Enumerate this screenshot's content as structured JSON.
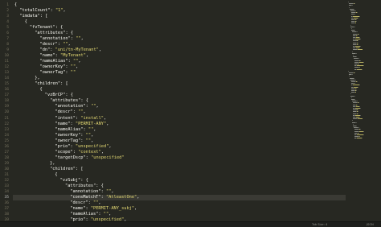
{
  "editor": {
    "language": "json",
    "active_line": 35,
    "colors": {
      "background": "#272822",
      "key": "#f8f8f2",
      "string": "#e6db74",
      "punctuation": "#f8f8f2",
      "line_number": "#75715e",
      "active_line_highlight": "#3a3a34"
    },
    "lines": [
      {
        "n": "1",
        "indent": 0,
        "tokens": [
          [
            "p",
            "{"
          ]
        ]
      },
      {
        "n": "2",
        "indent": 1,
        "tokens": [
          [
            "k",
            "\"totalCount\""
          ],
          [
            "p",
            ": "
          ],
          [
            "s",
            "\"1\""
          ],
          [
            "p",
            ","
          ]
        ]
      },
      {
        "n": "3",
        "indent": 1,
        "tokens": [
          [
            "k",
            "\"imdata\""
          ],
          [
            "p",
            ": ["
          ]
        ]
      },
      {
        "n": "4",
        "indent": 2,
        "tokens": [
          [
            "p",
            "{"
          ]
        ]
      },
      {
        "n": "5",
        "indent": 3,
        "tokens": [
          [
            "k",
            "\"fvTenant\""
          ],
          [
            "p",
            ": {"
          ]
        ]
      },
      {
        "n": "6",
        "indent": 4,
        "tokens": [
          [
            "k",
            "\"attributes\""
          ],
          [
            "p",
            ": {"
          ]
        ]
      },
      {
        "n": "7",
        "indent": 5,
        "tokens": [
          [
            "k",
            "\"annotation\""
          ],
          [
            "p",
            ": "
          ],
          [
            "s",
            "\"\""
          ],
          [
            "p",
            ","
          ]
        ]
      },
      {
        "n": "8",
        "indent": 5,
        "tokens": [
          [
            "k",
            "\"descr\""
          ],
          [
            "p",
            ": "
          ],
          [
            "s",
            "\"\""
          ],
          [
            "p",
            ","
          ]
        ]
      },
      {
        "n": "9",
        "indent": 5,
        "tokens": [
          [
            "k",
            "\"dn\""
          ],
          [
            "p",
            ": "
          ],
          [
            "s",
            "\"uni/tn-MyTenant\""
          ],
          [
            "p",
            ","
          ]
        ]
      },
      {
        "n": "10",
        "indent": 5,
        "tokens": [
          [
            "k",
            "\"name\""
          ],
          [
            "p",
            ": "
          ],
          [
            "s",
            "\"MyTenant\""
          ],
          [
            "p",
            ","
          ]
        ]
      },
      {
        "n": "11",
        "indent": 5,
        "tokens": [
          [
            "k",
            "\"nameAlias\""
          ],
          [
            "p",
            ": "
          ],
          [
            "s",
            "\"\""
          ],
          [
            "p",
            ","
          ]
        ]
      },
      {
        "n": "12",
        "indent": 5,
        "tokens": [
          [
            "k",
            "\"ownerKey\""
          ],
          [
            "p",
            ": "
          ],
          [
            "s",
            "\"\""
          ],
          [
            "p",
            ","
          ]
        ]
      },
      {
        "n": "13",
        "indent": 5,
        "tokens": [
          [
            "k",
            "\"ownerTag\""
          ],
          [
            "p",
            ": "
          ],
          [
            "s",
            "\"\""
          ]
        ]
      },
      {
        "n": "14",
        "indent": 4,
        "tokens": [
          [
            "p",
            "},"
          ]
        ]
      },
      {
        "n": "15",
        "indent": 4,
        "tokens": [
          [
            "k",
            "\"children\""
          ],
          [
            "p",
            ": ["
          ]
        ]
      },
      {
        "n": "16",
        "indent": 5,
        "tokens": [
          [
            "p",
            "{"
          ]
        ]
      },
      {
        "n": "17",
        "indent": 6,
        "tokens": [
          [
            "k",
            "\"vzBrCP\""
          ],
          [
            "p",
            ": {"
          ]
        ]
      },
      {
        "n": "18",
        "indent": 7,
        "tokens": [
          [
            "k",
            "\"attributes\""
          ],
          [
            "p",
            ": {"
          ]
        ]
      },
      {
        "n": "19",
        "indent": 8,
        "tokens": [
          [
            "k",
            "\"annotation\""
          ],
          [
            "p",
            ": "
          ],
          [
            "s",
            "\"\""
          ],
          [
            "p",
            ","
          ]
        ]
      },
      {
        "n": "20",
        "indent": 8,
        "tokens": [
          [
            "k",
            "\"descr\""
          ],
          [
            "p",
            ": "
          ],
          [
            "s",
            "\"\""
          ],
          [
            "p",
            ","
          ]
        ]
      },
      {
        "n": "21",
        "indent": 8,
        "tokens": [
          [
            "k",
            "\"intent\""
          ],
          [
            "p",
            ": "
          ],
          [
            "s",
            "\"install\""
          ],
          [
            "p",
            ","
          ]
        ]
      },
      {
        "n": "22",
        "indent": 8,
        "tokens": [
          [
            "k",
            "\"name\""
          ],
          [
            "p",
            ": "
          ],
          [
            "s",
            "\"PERMIT-ANY\""
          ],
          [
            "p",
            ","
          ]
        ]
      },
      {
        "n": "23",
        "indent": 8,
        "tokens": [
          [
            "k",
            "\"nameAlias\""
          ],
          [
            "p",
            ": "
          ],
          [
            "s",
            "\"\""
          ],
          [
            "p",
            ","
          ]
        ]
      },
      {
        "n": "24",
        "indent": 8,
        "tokens": [
          [
            "k",
            "\"ownerKey\""
          ],
          [
            "p",
            ": "
          ],
          [
            "s",
            "\"\""
          ],
          [
            "p",
            ","
          ]
        ]
      },
      {
        "n": "25",
        "indent": 8,
        "tokens": [
          [
            "k",
            "\"ownerTag\""
          ],
          [
            "p",
            ": "
          ],
          [
            "s",
            "\"\""
          ],
          [
            "p",
            ","
          ]
        ]
      },
      {
        "n": "26",
        "indent": 8,
        "tokens": [
          [
            "k",
            "\"prio\""
          ],
          [
            "p",
            ": "
          ],
          [
            "s",
            "\"unspecified\""
          ],
          [
            "p",
            ","
          ]
        ]
      },
      {
        "n": "27",
        "indent": 8,
        "tokens": [
          [
            "k",
            "\"scope\""
          ],
          [
            "p",
            ": "
          ],
          [
            "s",
            "\"context\""
          ],
          [
            "p",
            ","
          ]
        ]
      },
      {
        "n": "28",
        "indent": 8,
        "tokens": [
          [
            "k",
            "\"targetDscp\""
          ],
          [
            "p",
            ": "
          ],
          [
            "s",
            "\"unspecified\""
          ]
        ]
      },
      {
        "n": "29",
        "indent": 7,
        "tokens": [
          [
            "p",
            "},"
          ]
        ]
      },
      {
        "n": "30",
        "indent": 7,
        "tokens": [
          [
            "k",
            "\"children\""
          ],
          [
            "p",
            ": ["
          ]
        ]
      },
      {
        "n": "31",
        "indent": 8,
        "tokens": [
          [
            "p",
            "{"
          ]
        ]
      },
      {
        "n": "32",
        "indent": 9,
        "tokens": [
          [
            "k",
            "\"vzSubj\""
          ],
          [
            "p",
            ": {"
          ]
        ]
      },
      {
        "n": "33",
        "indent": 10,
        "tokens": [
          [
            "k",
            "\"attributes\""
          ],
          [
            "p",
            ": {"
          ]
        ]
      },
      {
        "n": "34",
        "indent": 11,
        "tokens": [
          [
            "k",
            "\"annotation\""
          ],
          [
            "p",
            ": "
          ],
          [
            "s",
            "\"\""
          ],
          [
            "p",
            ","
          ]
        ]
      },
      {
        "n": "35",
        "indent": 11,
        "tokens": [
          [
            "k",
            "\"consMatchT\""
          ],
          [
            "p",
            ": "
          ],
          [
            "s",
            "\"AtleastOne\""
          ],
          [
            "p",
            ","
          ]
        ]
      },
      {
        "n": "36",
        "indent": 11,
        "tokens": [
          [
            "k",
            "\"descr\""
          ],
          [
            "p",
            ": "
          ],
          [
            "s",
            "\"\""
          ],
          [
            "p",
            ","
          ]
        ]
      },
      {
        "n": "37",
        "indent": 11,
        "tokens": [
          [
            "k",
            "\"name\""
          ],
          [
            "p",
            ": "
          ],
          [
            "s",
            "\"PERMIT-ANY_subj\""
          ],
          [
            "p",
            ","
          ]
        ]
      },
      {
        "n": "38",
        "indent": 11,
        "tokens": [
          [
            "k",
            "\"nameAlias\""
          ],
          [
            "p",
            ": "
          ],
          [
            "s",
            "\"\""
          ],
          [
            "p",
            ","
          ]
        ]
      },
      {
        "n": "39",
        "indent": 11,
        "tokens": [
          [
            "k",
            "\"prio\""
          ],
          [
            "p",
            ": "
          ],
          [
            "s",
            "\"unspecified\""
          ],
          [
            "p",
            ","
          ]
        ]
      }
    ]
  },
  "statusbar": {
    "tab_size": "Tab Size: 4",
    "syntax": "JSON"
  }
}
